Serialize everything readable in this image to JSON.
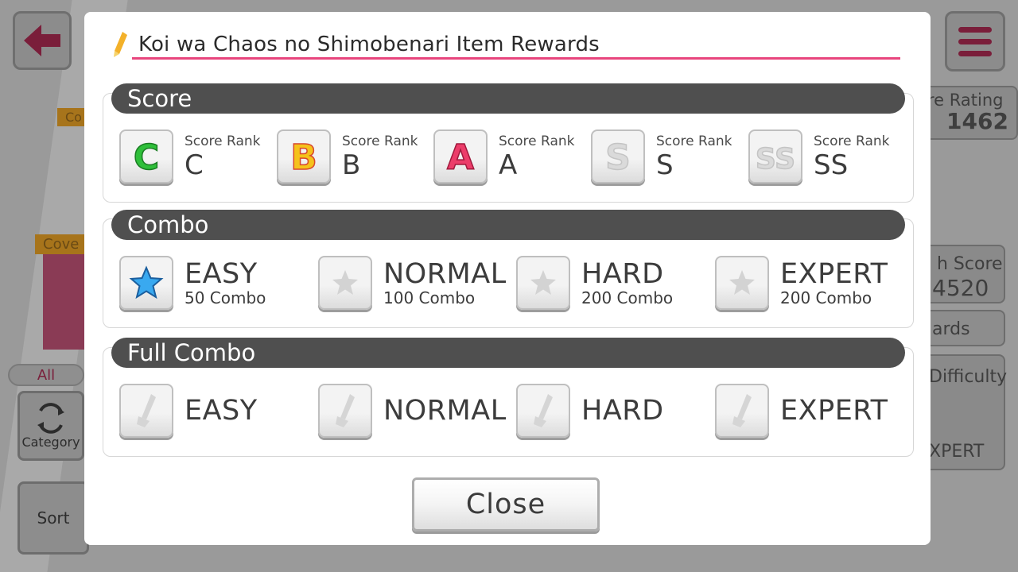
{
  "background": {
    "partial_texts": {
      "rating_label": "re Rating",
      "rating_value": "1462",
      "hi_score_label": "h Score",
      "hi_score_value": "4520",
      "rewards_fragment": "ards",
      "difficulty_label": "Difficulty",
      "difficulty_value": "XPERT",
      "all_tab": "All",
      "category_label": "Category",
      "sort_label": "Sort",
      "cover_tag": "Cove",
      "cover_tag_small": "Co"
    }
  },
  "modal": {
    "title": "Koi wa Chaos no Shimobenari Item Rewards",
    "score_section": {
      "header": "Score",
      "items": [
        {
          "caption": "Score Rank",
          "rank": "C",
          "icon": "rank-c-icon",
          "color": "#2fbf3a"
        },
        {
          "caption": "Score Rank",
          "rank": "B",
          "icon": "rank-b-icon",
          "color": "#f2a51b"
        },
        {
          "caption": "Score Rank",
          "rank": "A",
          "icon": "rank-a-icon",
          "color": "#e8305f"
        },
        {
          "caption": "Score Rank",
          "rank": "S",
          "icon": "rank-s-icon",
          "color": "#d6d6d6"
        },
        {
          "caption": "Score Rank",
          "rank": "SS",
          "icon": "rank-ss-icon",
          "color": "#d6d6d6"
        }
      ]
    },
    "combo_section": {
      "header": "Combo",
      "items": [
        {
          "difficulty": "EASY",
          "count": "50 Combo",
          "icon": "star-icon",
          "achieved": true
        },
        {
          "difficulty": "NORMAL",
          "count": "100 Combo",
          "icon": "star-icon",
          "achieved": false
        },
        {
          "difficulty": "HARD",
          "count": "200 Combo",
          "icon": "star-icon",
          "achieved": false
        },
        {
          "difficulty": "EXPERT",
          "count": "200 Combo",
          "icon": "star-icon",
          "achieved": false
        }
      ]
    },
    "full_combo_section": {
      "header": "Full Combo",
      "items": [
        {
          "difficulty": "EASY",
          "icon": "full-combo-icon"
        },
        {
          "difficulty": "NORMAL",
          "icon": "full-combo-icon"
        },
        {
          "difficulty": "HARD",
          "icon": "full-combo-icon"
        },
        {
          "difficulty": "EXPERT",
          "icon": "full-combo-icon"
        }
      ]
    },
    "close_label": "Close"
  },
  "colors": {
    "accent": "#e8457d",
    "header_bar": "#4f4f4f",
    "star_blue": "#39a9f0"
  }
}
